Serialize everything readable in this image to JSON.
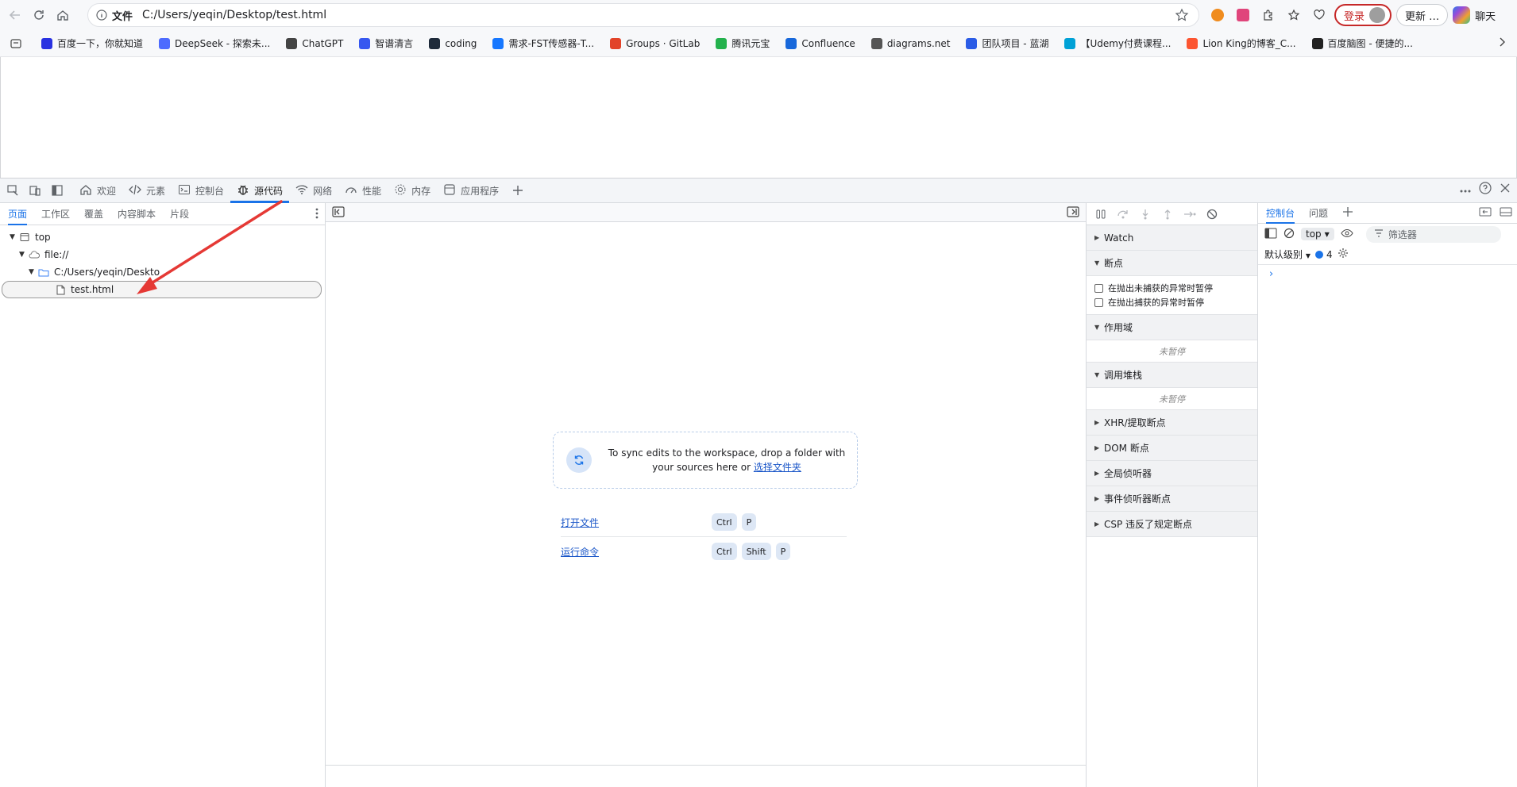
{
  "browser": {
    "address": {
      "scheme_label": "文件",
      "url": "C:/Users/yeqin/Desktop/test.html"
    },
    "login_label": "登录",
    "update_label": "更新 …",
    "chat_label": "聊天",
    "bookmarks": [
      {
        "label": "百度一下，你就知道",
        "color": "#2932e1"
      },
      {
        "label": "DeepSeek - 探索未...",
        "color": "#4d6bfe"
      },
      {
        "label": "ChatGPT",
        "color": "#444444"
      },
      {
        "label": "智谱清言",
        "color": "#3657f0"
      },
      {
        "label": "coding",
        "color": "#1e2a3a"
      },
      {
        "label": "需求-FST传感器-T...",
        "color": "#1677ff"
      },
      {
        "label": "Groups · GitLab",
        "color": "#e24329"
      },
      {
        "label": "腾讯元宝",
        "color": "#23b14d"
      },
      {
        "label": "Confluence",
        "color": "#1868db"
      },
      {
        "label": "diagrams.net",
        "color": "#555555"
      },
      {
        "label": "团队项目 - 蓝湖",
        "color": "#2b5ce6"
      },
      {
        "label": "【Udemy付费课程...",
        "color": "#00a1d6"
      },
      {
        "label": "Lion King的博客_C...",
        "color": "#fc5531"
      },
      {
        "label": "百度脑图 - 便捷的...",
        "color": "#222222"
      }
    ]
  },
  "devtools": {
    "tabs": [
      {
        "label": "欢迎",
        "icon": "home-icon"
      },
      {
        "label": "元素",
        "icon": "code-icon"
      },
      {
        "label": "控制台",
        "icon": "console-icon"
      },
      {
        "label": "源代码",
        "icon": "bug-icon",
        "active": true
      },
      {
        "label": "网络",
        "icon": "wifi-icon"
      },
      {
        "label": "性能",
        "icon": "gauge-icon"
      },
      {
        "label": "内存",
        "icon": "gear-icon"
      },
      {
        "label": "应用程序",
        "icon": "app-icon"
      }
    ],
    "navigator": {
      "tabs": [
        "页面",
        "工作区",
        "覆盖",
        "内容脚本",
        "片段"
      ],
      "tree": {
        "top": "top",
        "origin": "file://",
        "folder": "C:/Users/yeqin/Deskto",
        "file": "test.html"
      }
    },
    "editor": {
      "sync_text": "To sync edits to the workspace, drop a folder with your sources here or",
      "sync_link": "选择文件夹",
      "shortcuts": [
        {
          "label": "打开文件",
          "keys": [
            "Ctrl",
            "P"
          ]
        },
        {
          "label": "运行命令",
          "keys": [
            "Ctrl",
            "Shift",
            "P"
          ]
        }
      ]
    },
    "debugger": {
      "watch": "Watch",
      "breakpoints": "断点",
      "pause_uncaught": "在抛出未捕获的异常时暂停",
      "pause_caught": "在抛出捕获的异常时暂停",
      "scope": "作用域",
      "not_paused": "未暂停",
      "call_stack": "调用堆栈",
      "xhr": "XHR/提取断点",
      "dom": "DOM 断点",
      "global_listeners": "全局侦听器",
      "event_listeners": "事件侦听器断点",
      "csp": "CSP 违反了规定断点"
    },
    "console": {
      "tabs": [
        "控制台",
        "问题"
      ],
      "context": "top",
      "filter_placeholder": "筛选器",
      "level": "默认级别",
      "message_count": "4"
    }
  },
  "colors": {
    "accent": "#1a73e8",
    "annotation_arrow": "#e53935"
  }
}
